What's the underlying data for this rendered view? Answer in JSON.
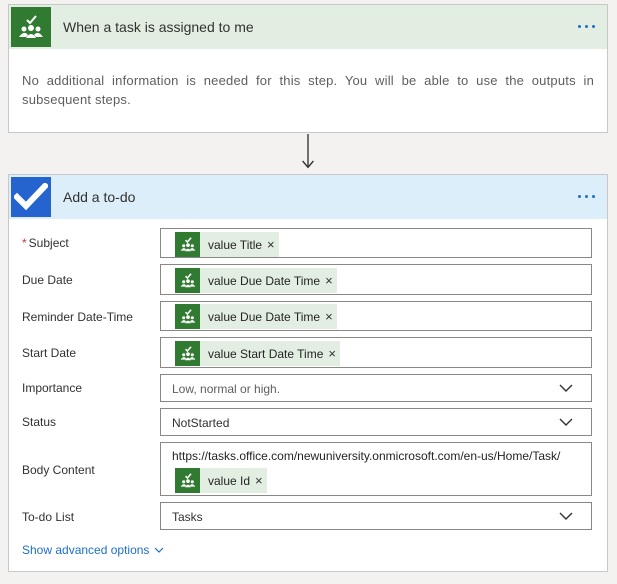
{
  "trigger": {
    "title": "When a task is assigned to me",
    "info": "No additional information is needed for this step. You will be able to use the outputs in subsequent steps.",
    "icon": "planner-icon",
    "header_color": "#e1eee1",
    "icon_color": "#317a31"
  },
  "action": {
    "title": "Add a to-do",
    "icon": "todo-check-icon",
    "header_color": "#dceefa",
    "icon_color": "#2564cf",
    "fields": {
      "subject": {
        "label": "Subject",
        "required_mark": "*",
        "token": "value Title",
        "token_remove": "×"
      },
      "due_date": {
        "label": "Due Date",
        "token": "value Due Date Time",
        "token_remove": "×"
      },
      "reminder": {
        "label": "Reminder Date-Time",
        "token": "value Due Date Time",
        "token_remove": "×"
      },
      "start_date": {
        "label": "Start Date",
        "token": "value Start Date Time",
        "token_remove": "×"
      },
      "importance": {
        "label": "Importance",
        "placeholder": "Low, normal or high."
      },
      "status": {
        "label": "Status",
        "value": "NotStarted"
      },
      "body_content": {
        "label": "Body Content",
        "text": "https://tasks.office.com/newuniversity.onmicrosoft.com/en-us/Home/Task/",
        "token": "value Id",
        "token_remove": "×"
      },
      "todo_list": {
        "label": "To-do List",
        "value": "Tasks"
      }
    },
    "advanced_link": "Show advanced options"
  },
  "accent_color": "#1f6fc5"
}
